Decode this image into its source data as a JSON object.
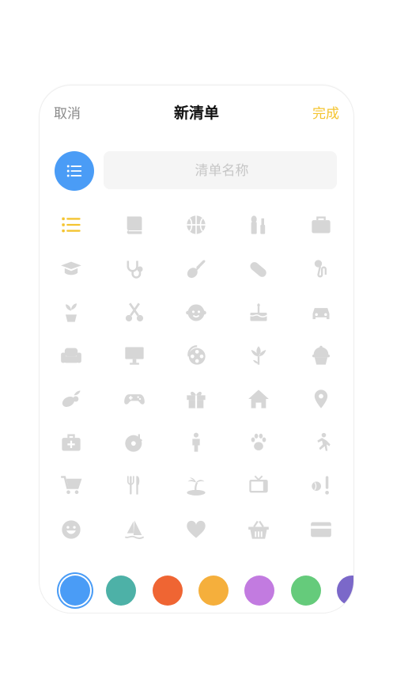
{
  "header": {
    "cancel_label": "取消",
    "title": "新清单",
    "done_label": "完成"
  },
  "name_input": {
    "placeholder": "清单名称",
    "value": ""
  },
  "selected_icon": "list-icon",
  "icons": [
    [
      "list-icon",
      "book-icon",
      "basketball-icon",
      "cosmetics-icon",
      "briefcase-icon"
    ],
    [
      "graduation-cap-icon",
      "stethoscope-icon",
      "guitar-icon",
      "pill-icon",
      "microphone-icon"
    ],
    [
      "potted-plant-icon",
      "scissors-icon",
      "baby-face-icon",
      "birthday-cake-icon",
      "car-icon"
    ],
    [
      "sofa-icon",
      "monitor-icon",
      "film-reel-icon",
      "lotus-icon",
      "cupcake-icon"
    ],
    [
      "vegetables-icon",
      "gamepad-icon",
      "gift-icon",
      "house-icon",
      "location-pin-icon"
    ],
    [
      "first-aid-kit-icon",
      "music-disc-icon",
      "person-icon",
      "paw-icon",
      "running-icon"
    ],
    [
      "shopping-cart-icon",
      "cutlery-icon",
      "island-icon",
      "tv-icon",
      "baseball-icon"
    ],
    [
      "smiley-icon",
      "windsurf-icon",
      "heart-icon",
      "basket-icon",
      "credit-card-icon"
    ]
  ],
  "colors": {
    "icon_default": "#d6d6d6",
    "icon_selected": "#f4c430",
    "accent": "#4a9cf6",
    "swatches": [
      "#4a9cf6",
      "#4db1a7",
      "#ef6533",
      "#f5af3c",
      "#c27be0",
      "#65cb7b",
      "#7b68c9"
    ],
    "selected_swatch": 0
  }
}
